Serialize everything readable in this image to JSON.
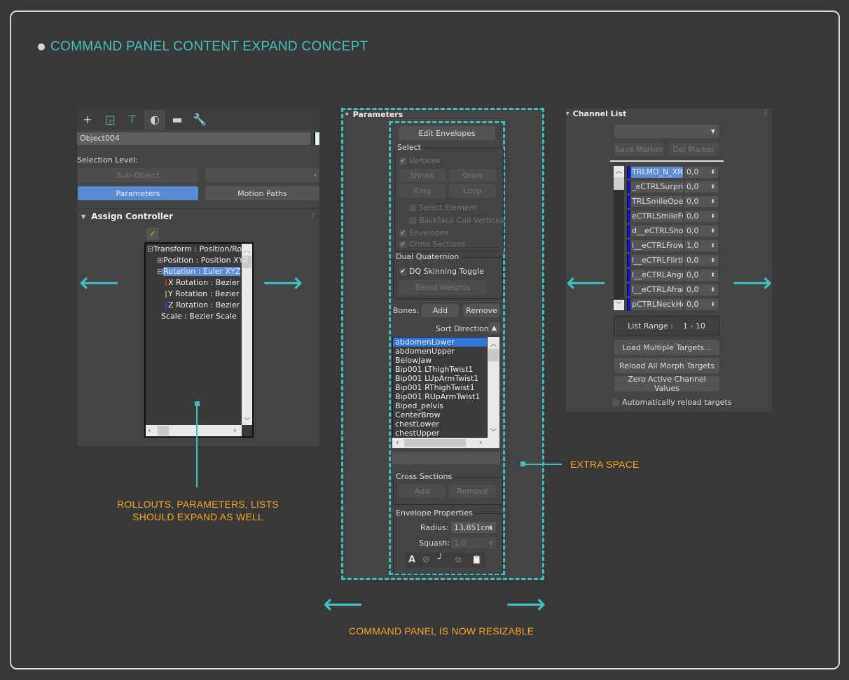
{
  "title": "COMMAND PANEL CONTENT EXPAND CONCEPT",
  "colors": {
    "accent": "#46c1c3",
    "annotation": "#f6a623",
    "selection": "#5b8cd3",
    "list_selection": "#2f76d6",
    "channel_bar": "#1515c8"
  },
  "left_panel": {
    "tabs": [
      {
        "icon": "plus-icon",
        "glyph": "+"
      },
      {
        "icon": "modify-icon",
        "glyph": "◲"
      },
      {
        "icon": "hierarchy-icon",
        "glyph": "⊤"
      },
      {
        "icon": "motion-icon",
        "glyph": "◐"
      },
      {
        "icon": "display-icon",
        "glyph": "▬"
      },
      {
        "icon": "utilities-icon",
        "glyph": "🔧"
      }
    ],
    "object_name": "Object004",
    "selection_level_label": "Selection Level:",
    "sub_object_label": "Sub-Object",
    "parameters_label": "Parameters",
    "motion_paths_label": "Motion Paths",
    "rollout_title": "Assign Controller",
    "tree": [
      {
        "label": "Transform : Position/Rotat",
        "expander": "⊟"
      },
      {
        "label": "Position : Position XYZ",
        "expander": "⊞"
      },
      {
        "label": "Rotation : Euler XYZ",
        "expander": "⊟",
        "selected": true
      },
      {
        "label": "X Rotation : Bezier F",
        "axis_color": "#d03030"
      },
      {
        "label": "Y Rotation : Bezier F",
        "axis_color": "#6cb030"
      },
      {
        "label": "Z Rotation : Bezier F",
        "axis_color": "#3040e0"
      },
      {
        "label": "Scale : Bezier Scale"
      }
    ]
  },
  "center_panel": {
    "rollout_title": "Parameters",
    "edit_envelopes": "Edit Envelopes",
    "select_group": "Select",
    "vertices": "Vertices",
    "shrink": "Shrink",
    "grow": "Grow",
    "ring": "Ring",
    "loop": "Loop",
    "select_element": "Select Element",
    "backface_cull": "Backface Cull Vertices",
    "envelopes": "Envelopes",
    "cross_sections_chk": "Cross Sections",
    "dual_quaternion_group": "Dual Quaternion",
    "dq_toggle": "DQ Skinning Toggle",
    "blend_weights": "Blend Weights",
    "bones_label": "Bones:",
    "bones_add": "Add",
    "bones_remove": "Remove",
    "sort_direction": "Sort Direction:",
    "bones": [
      "abdomenLower",
      "abdomenUpper",
      "BelowJaw",
      "Bip001 LThighTwist1",
      "Bip001 LUpArmTwist1",
      "Bip001 RThighTwist1",
      "Bip001 RUpArmTwist1",
      "Biped_pelvis",
      "CenterBrow",
      "chestLower",
      "chestUpper"
    ],
    "cross_sections_group": "Cross Sections",
    "cs_add": "Add",
    "cs_remove": "Remove",
    "envelope_props_group": "Envelope Properties",
    "radius_label": "Radius:",
    "radius_value": "13,851cm",
    "squash_label": "Squash:",
    "squash_value": "1,0",
    "tool_icons": [
      "absolute-icon",
      "paperclip-icon",
      "falloff-curve-icon",
      "copy-icon",
      "paste-icon"
    ]
  },
  "right_panel": {
    "rollout_title": "Channel List",
    "save_marker": "Save Marker",
    "del_marker": "Del Marker",
    "channels": [
      {
        "name": "TRLMD_N_XRot",
        "value": "0,0",
        "selected": true
      },
      {
        "name": "_eCTRLSurprise",
        "value": "0,0"
      },
      {
        "name": "TRLSmileOpenFu",
        "value": "0,0"
      },
      {
        "name": "eCTRLSmileFullF",
        "value": "0,0"
      },
      {
        "name": "d__eCTRLShock",
        "value": "0,0"
      },
      {
        "name": "l__eCTRLFrown",
        "value": "1,0"
      },
      {
        "name": "l__eCTRLFlirting",
        "value": "0,0"
      },
      {
        "name": "l__eCTRLAngry",
        "value": "0,0"
      },
      {
        "name": "l__eCTRLAfraid",
        "value": "0,0"
      },
      {
        "name": "pCTRLNeckHea",
        "value": "0,0"
      }
    ],
    "list_range_label": "List Range :",
    "list_range_value": "1 - 10",
    "load_multiple": "Load Multiple Targets...",
    "reload_all": "Reload All Morph Targets",
    "zero_active": "Zero Active Channel Values",
    "auto_reload": "Automatically reload targets"
  },
  "annotations": {
    "rollouts": "ROLLOUTS, PARAMETERS, LISTS\nSHOULD EXPAND AS WELL",
    "extra_space": "EXTRA SPACE",
    "resizable": "COMMAND PANEL IS NOW RESIZABLE"
  }
}
